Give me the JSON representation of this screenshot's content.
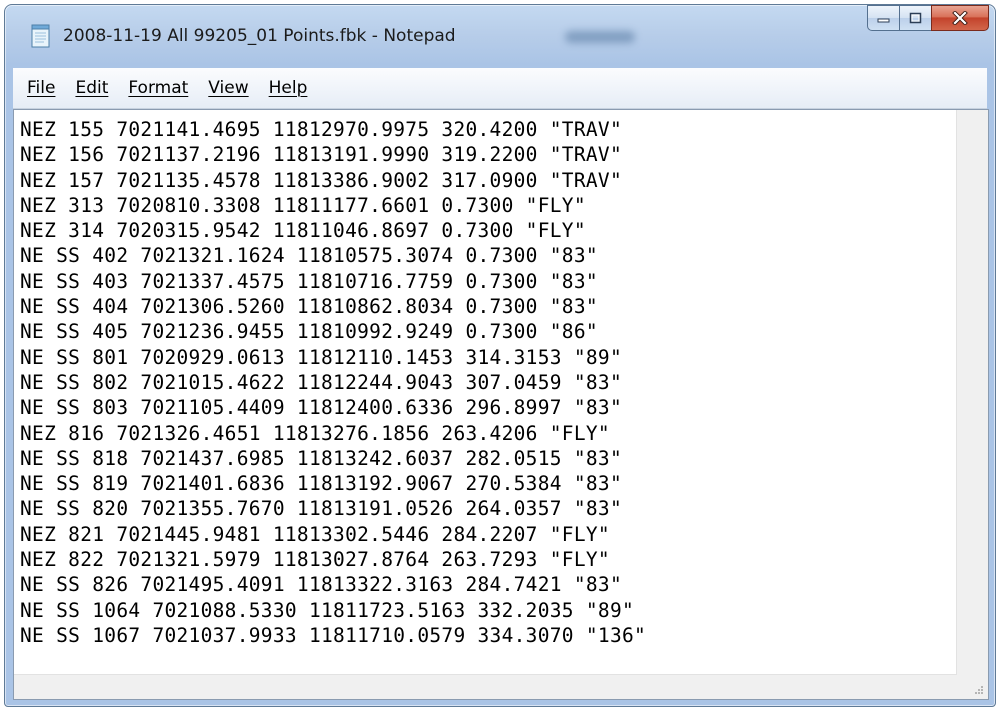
{
  "window": {
    "title": "2008-11-19 All 99205_01 Points.fbk - Notepad",
    "accent_color": "#b9d1ea",
    "close_color": "#c7432c"
  },
  "menu": [
    "File",
    "Edit",
    "Format",
    "View",
    "Help"
  ],
  "icons": {
    "app": "notepad-icon",
    "minimize": "minimize-icon",
    "maximize": "maximize-icon",
    "close": "close-icon",
    "scroll_up": "scroll-up-arrow-icon",
    "scroll_down": "scroll-down-arrow-icon",
    "scroll_left": "scroll-left-arrow-icon",
    "scroll_right": "scroll-right-arrow-icon",
    "grip": "size-grip-icon"
  },
  "lines": [
    "NEZ 155 7021141.4695 11812970.9975 320.4200 \"TRAV\"",
    "NEZ 156 7021137.2196 11813191.9990 319.2200 \"TRAV\"",
    "NEZ 157 7021135.4578 11813386.9002 317.0900 \"TRAV\"",
    "NEZ 313 7020810.3308 11811177.6601 0.7300 \"FLY\"",
    "NEZ 314 7020315.9542 11811046.8697 0.7300 \"FLY\"",
    "NE SS 402 7021321.1624 11810575.3074 0.7300 \"83\"",
    "NE SS 403 7021337.4575 11810716.7759 0.7300 \"83\"",
    "NE SS 404 7021306.5260 11810862.8034 0.7300 \"83\"",
    "NE SS 405 7021236.9455 11810992.9249 0.7300 \"86\"",
    "NE SS 801 7020929.0613 11812110.1453 314.3153 \"89\"",
    "NE SS 802 7021015.4622 11812244.9043 307.0459 \"83\"",
    "NE SS 803 7021105.4409 11812400.6336 296.8997 \"83\"",
    "NEZ 816 7021326.4651 11813276.1856 263.4206 \"FLY\"",
    "NE SS 818 7021437.6985 11813242.6037 282.0515 \"83\"",
    "NE SS 819 7021401.6836 11813192.9067 270.5384 \"83\"",
    "NE SS 820 7021355.7670 11813191.0526 264.0357 \"83\"",
    "NEZ 821 7021445.9481 11813302.5446 284.2207 \"FLY\"",
    "NEZ 822 7021321.5979 11813027.8764 263.7293 \"FLY\"",
    "NE SS 826 7021495.4091 11813322.3163 284.7421 \"83\"",
    "NE SS 1064 7021088.5330 11811723.5163 332.2035 \"89\"",
    "NE SS 1067 7021037.9933 11811710.0579 334.3070 \"136\""
  ]
}
